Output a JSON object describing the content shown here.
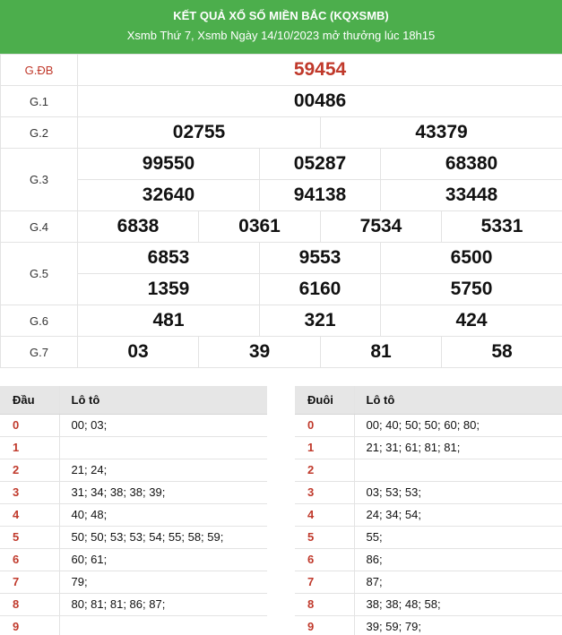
{
  "header": {
    "title": "KẾT QUẢ XỔ SỐ MIỀN BẮC (KQXSMB)",
    "subtitle": "Xsmb Thứ 7, Xsmb Ngày 14/10/2023 mở thưởng lúc 18h15"
  },
  "prizes": {
    "db": {
      "label": "G.ĐB",
      "values": [
        "59454"
      ]
    },
    "g1": {
      "label": "G.1",
      "values": [
        "00486"
      ]
    },
    "g2": {
      "label": "G.2",
      "values": [
        "02755",
        "43379"
      ]
    },
    "g3": {
      "label": "G.3",
      "values": [
        "99550",
        "05287",
        "68380",
        "32640",
        "94138",
        "33448"
      ]
    },
    "g4": {
      "label": "G.4",
      "values": [
        "6838",
        "0361",
        "7534",
        "5331"
      ]
    },
    "g5": {
      "label": "G.5",
      "values": [
        "6853",
        "9553",
        "6500",
        "1359",
        "6160",
        "5750"
      ]
    },
    "g6": {
      "label": "G.6",
      "values": [
        "481",
        "321",
        "424"
      ]
    },
    "g7": {
      "label": "G.7",
      "values": [
        "03",
        "39",
        "81",
        "58"
      ]
    }
  },
  "loto_head": {
    "col1": "Đầu",
    "col2": "Lô tô",
    "rows": [
      {
        "k": "0",
        "v": "00; 03;"
      },
      {
        "k": "1",
        "v": ""
      },
      {
        "k": "2",
        "v": "21; 24;"
      },
      {
        "k": "3",
        "v": "31; 34; 38; 38; 39;"
      },
      {
        "k": "4",
        "v": "40; 48;"
      },
      {
        "k": "5",
        "v": "50; 50; 53; 53; 54; 55; 58; 59;"
      },
      {
        "k": "6",
        "v": "60; 61;"
      },
      {
        "k": "7",
        "v": "79;"
      },
      {
        "k": "8",
        "v": "80; 81; 81; 86; 87;"
      },
      {
        "k": "9",
        "v": ""
      }
    ]
  },
  "loto_tail": {
    "col1": "Đuôi",
    "col2": "Lô tô",
    "rows": [
      {
        "k": "0",
        "v": "00; 40; 50; 50; 60; 80;"
      },
      {
        "k": "1",
        "v": "21; 31; 61; 81; 81;"
      },
      {
        "k": "2",
        "v": ""
      },
      {
        "k": "3",
        "v": "03; 53; 53;"
      },
      {
        "k": "4",
        "v": "24; 34; 54;"
      },
      {
        "k": "5",
        "v": "55;"
      },
      {
        "k": "6",
        "v": "86;"
      },
      {
        "k": "7",
        "v": "87;"
      },
      {
        "k": "8",
        "v": "38; 38; 48; 58;"
      },
      {
        "k": "9",
        "v": "39; 59; 79;"
      }
    ]
  }
}
